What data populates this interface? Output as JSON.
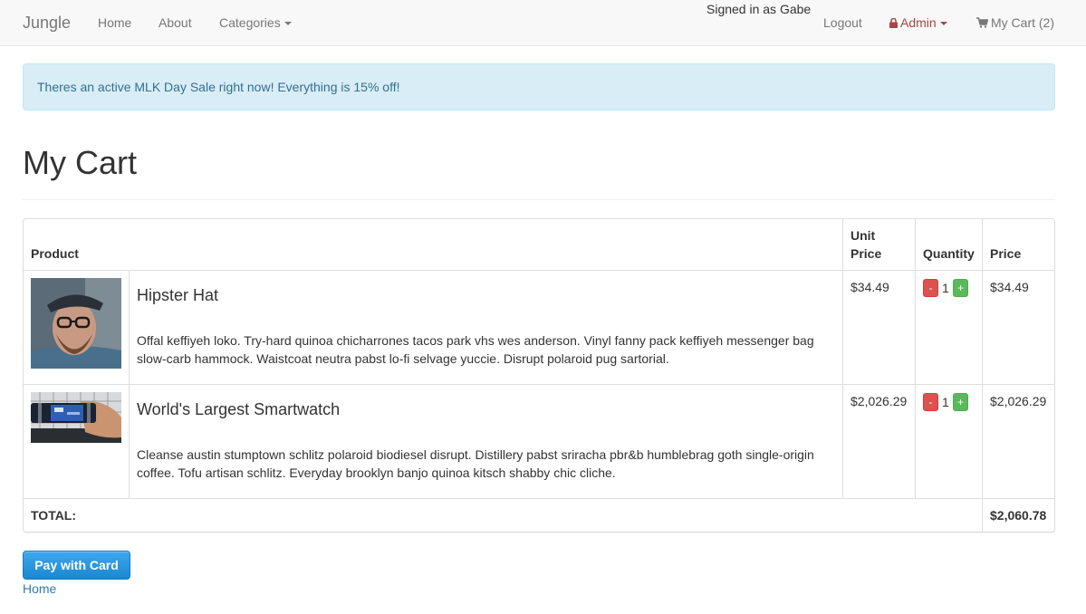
{
  "navbar": {
    "brand": "Jungle",
    "home": "Home",
    "about": "About",
    "categories": "Categories",
    "signed_in": "Signed in as Gabe",
    "logout": "Logout",
    "admin": "Admin",
    "cart": "My Cart (2)",
    "admin_color": "#a94442"
  },
  "alert": {
    "text": "Theres an active MLK Day Sale right now! Everything is 15% off!"
  },
  "page": {
    "title": "My Cart"
  },
  "table": {
    "headers": {
      "product": "Product",
      "unit_price": "Unit Price",
      "quantity": "Quantity",
      "price": "Price"
    },
    "rows": [
      {
        "name": "Hipster Hat",
        "description": "Offal keffiyeh loko. Try-hard quinoa chicharrones tacos park vhs wes anderson. Vinyl fanny pack keffiyeh messenger bag slow-carb hammock. Waistcoat neutra pabst lo-fi selvage yuccie. Disrupt polaroid pug sartorial.",
        "unit_price": "$34.49",
        "quantity": "1",
        "price": "$34.49",
        "minus": "-",
        "plus": "+"
      },
      {
        "name": "World's Largest Smartwatch",
        "description": "Cleanse austin stumptown schlitz polaroid biodiesel disrupt. Distillery pabst sriracha pbr&b humblebrag goth single-origin coffee. Tofu artisan schlitz. Everyday brooklyn banjo quinoa kitsch shabby chic cliche.",
        "unit_price": "$2,026.29",
        "quantity": "1",
        "price": "$2,026.29",
        "minus": "-",
        "plus": "+"
      }
    ],
    "total_label": "TOTAL:",
    "total_value": "$2,060.78"
  },
  "actions": {
    "pay": "Pay with Card",
    "home": "Home"
  }
}
